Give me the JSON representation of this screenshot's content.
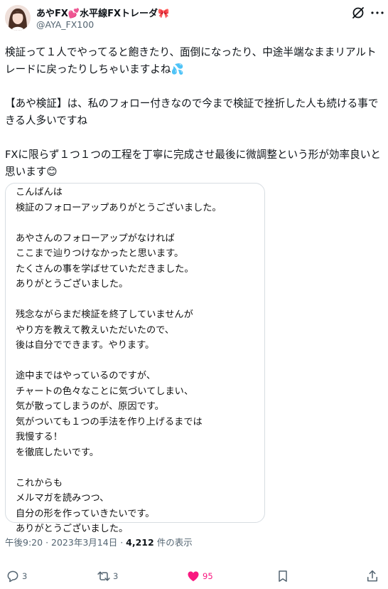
{
  "user": {
    "display_name": "あやFX💕水平線FXトレーダ🎀",
    "handle": "@AYA_FX100"
  },
  "tweet": {
    "paragraphs": [
      "検証って１人でやってると飽きたり、面倒になったり、中途半端なままリアルトレードに戻ったりしちゃいますよね💦",
      "【あや検証】は、私のフォロー付きなので今まで検証で挫折した人も続ける事できる人多いですね",
      "FXに限らず１つ１つの工程を丁寧に完成させ最後に微調整という形が効率良いと思います😊"
    ]
  },
  "letter": {
    "paragraphs": [
      [
        "こんばんは",
        "検証のフォローアップありがとうございました。"
      ],
      [
        "あやさんのフォローアップがなければ",
        "ここまで辿りつけなかったと思います。",
        "たくさんの事を学ばせていただきました。",
        "ありがとうございました。"
      ],
      [
        "残念ながらまだ検証を終了していませんが",
        "やり方を教えて教えいただいたので、",
        "後は自分でできます。やります。"
      ],
      [
        "途中まではやっているのですが、",
        "チャートの色々なことに気づいてしまい、",
        "気が散ってしまうのが、原因です。",
        "気がついても１つの手法を作り上げるまでは",
        "我慢する！",
        "を徹底したいです。"
      ],
      [
        "これからも",
        "メルマガを読みつつ、",
        "自分の形を作っていきたいです。",
        "ありがとうございました。"
      ]
    ]
  },
  "meta": {
    "time": "午後9:20",
    "separator": "·",
    "date": "2023年3月14日",
    "views_count": "4,212",
    "views_label": "件の表示"
  },
  "actions": {
    "reply_count": "3",
    "retweet_count": "3",
    "like_count": "95"
  },
  "colors": {
    "text": "#0f1419",
    "muted": "#536471",
    "like": "#f91880",
    "border": "#d7dde2"
  }
}
